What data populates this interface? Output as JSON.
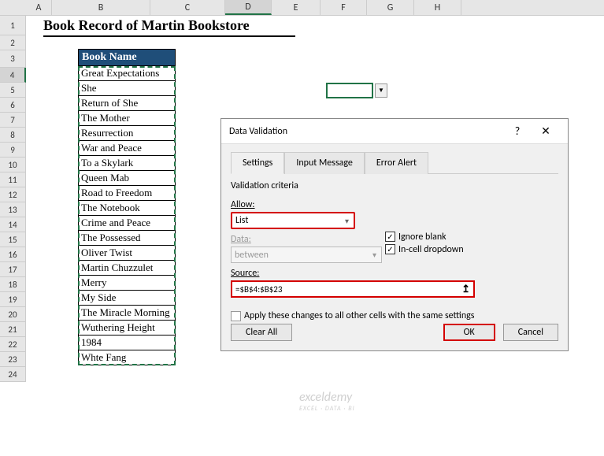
{
  "cols": {
    "A": 33,
    "B": 125,
    "C": 95,
    "D": 59,
    "E": 62,
    "F": 59,
    "G": 60,
    "H": 60
  },
  "selected_col": "D",
  "selected_row": 4,
  "title": "Book Record of Martin Bookstore",
  "header": "Book Name",
  "books": [
    "Great Expectations",
    "She",
    "Return of She",
    "The Mother",
    "Resurrection",
    "War and Peace",
    "To a Skylark",
    "Queen Mab",
    "Road to Freedom",
    "The Notebook",
    "Crime and Peace",
    "The Possessed",
    "Oliver Twist",
    "Martin Chuzzulet",
    "Merry",
    "My Side",
    "The Miracle Morning",
    "Wuthering Height",
    "1984",
    "Whte Fang"
  ],
  "dialog": {
    "title": "Data Validation",
    "help": "?",
    "close": "✕",
    "tabs": [
      "Settings",
      "Input Message",
      "Error Alert"
    ],
    "active_tab": 0,
    "criteria_label": "Validation criteria",
    "allow_label": "Allow:",
    "allow_value": "List",
    "ignore_blank": "Ignore blank",
    "ignore_blank_checked": true,
    "incell_dropdown": "In-cell dropdown",
    "incell_checked": true,
    "data_label": "Data:",
    "data_value": "between",
    "source_label": "Source:",
    "source_value": "=$B$4:$B$23",
    "apply_label": "Apply these changes to all other cells with the same settings",
    "clear_btn": "Clear All",
    "ok_btn": "OK",
    "cancel_btn": "Cancel"
  },
  "watermark": {
    "main": "exceldemy",
    "sub": "EXCEL · DATA · BI"
  }
}
